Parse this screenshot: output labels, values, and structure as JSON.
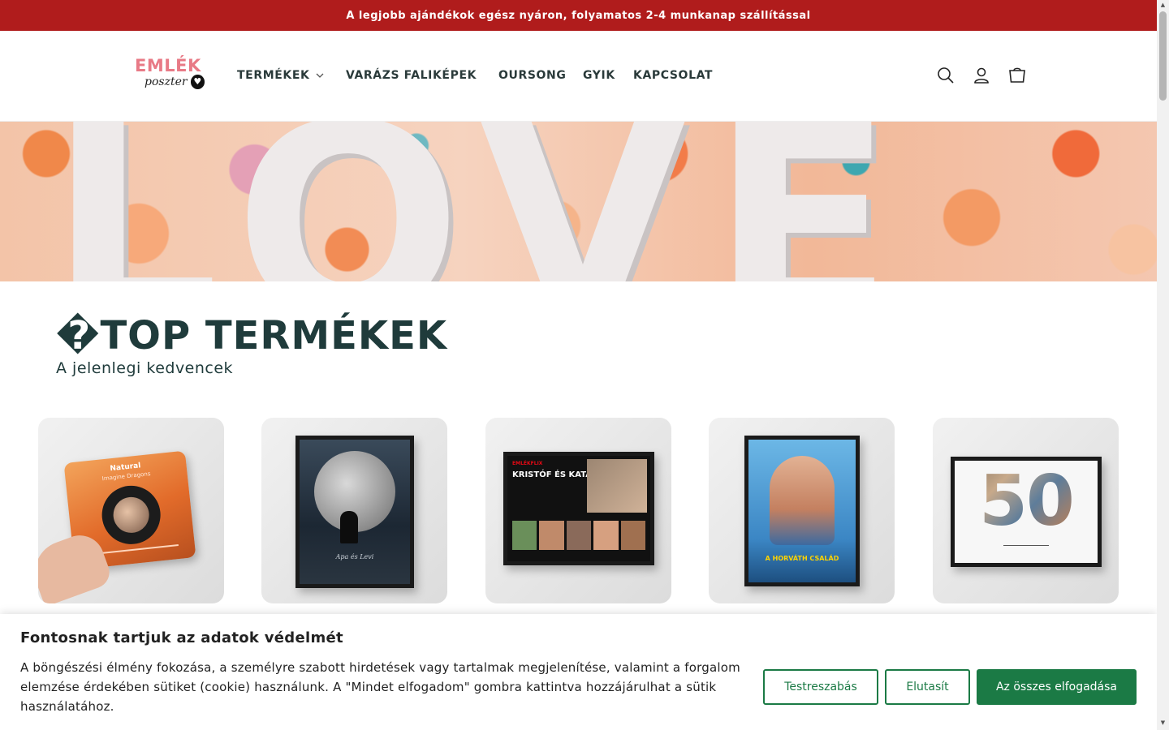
{
  "announcement": "A legjobb ajándékok egész nyáron, folyamatos 2-4 munkanap szállítással",
  "logo": {
    "top": "EMLÉK",
    "bottom": "poszter"
  },
  "nav": [
    {
      "label": "TERMÉKEK"
    },
    {
      "label": "VARÁZS FALIKÉPEK"
    },
    {
      "label": "OURSONG"
    },
    {
      "label": "GYIK"
    },
    {
      "label": "KAPCSOLAT"
    }
  ],
  "hero": {
    "word": "LOVE"
  },
  "section": {
    "title": "TOP TERMÉKEK",
    "title_prefix": "�",
    "subtitle": "A jelenlegi kedvencek"
  },
  "products": [
    {
      "song": "Natural",
      "artist": "Imagine Dragons"
    },
    {
      "caption": "Apa és Levi"
    },
    {
      "brand": "EMLÉKFLIX",
      "title": "KRISTÓF ÉS KATA"
    },
    {
      "title": "A HORVÁTH CSALÁD"
    },
    {
      "number": "50"
    }
  ],
  "cookie": {
    "title": "Fontosnak tartjuk az adatok védelmét",
    "text": "A böngészési élmény fokozása, a személyre szabott hirdetések vagy tartalmak megjelenítése, valamint a forgalom elemzése érdekében sütiket (cookie) használunk. A \"Mindet elfogadom\" gombra kattintva hozzájárulhat a sütik használatához.",
    "customize": "Testreszabás",
    "reject": "Elutasít",
    "accept_all": "Az összes elfogadása"
  },
  "colors": {
    "announce_bg": "#b01c1c",
    "accent_green": "#1b7a45",
    "heading": "#1f3b3b"
  }
}
